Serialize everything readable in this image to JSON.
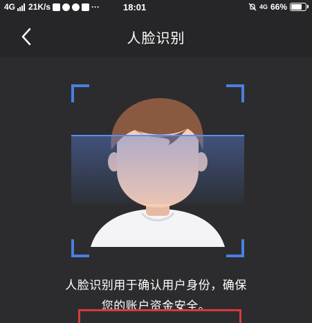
{
  "status_bar": {
    "network": "4G",
    "speed": "21K/s",
    "more": "···",
    "time": "18:01",
    "network_right": "4G",
    "battery": "66%"
  },
  "nav": {
    "title": "人脸识别",
    "back_icon": "chevron-left-icon"
  },
  "scan": {
    "illustration": "face-avatar-icon",
    "accent_color": "#4a7fe0"
  },
  "tip": {
    "line1": "人脸识别用于确认用户身份，确保",
    "line2": "您的账户资金安全。"
  },
  "highlight": {
    "color": "#d93a3a"
  }
}
